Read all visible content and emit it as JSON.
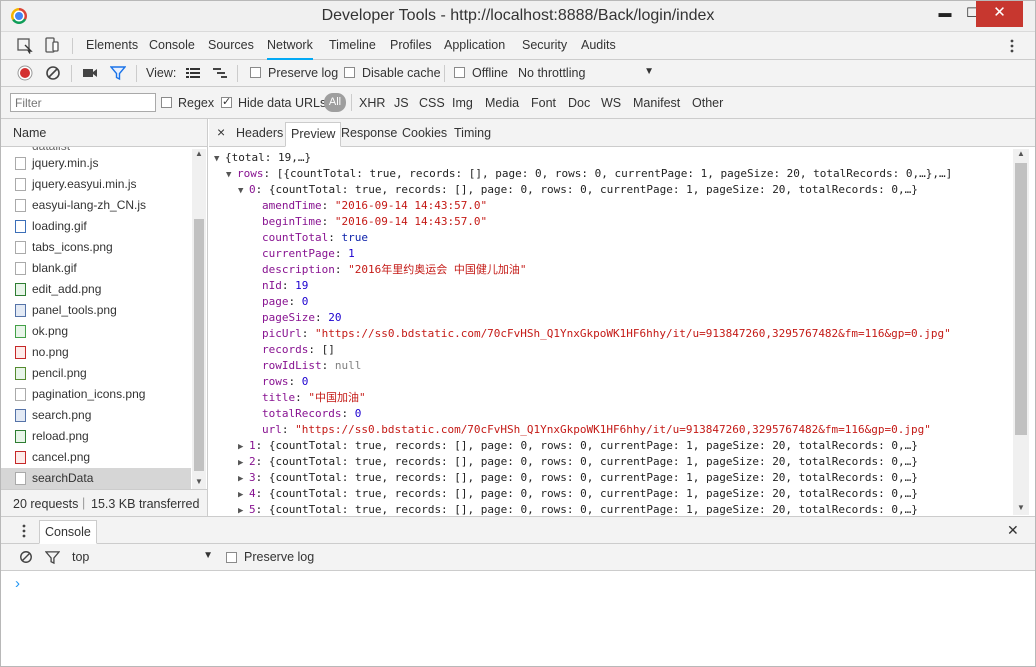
{
  "window": {
    "title": "Developer Tools - http://localhost:8888/Back/login/index",
    "min_label": "▬",
    "max_label": "☐",
    "close_label": "✕"
  },
  "tabs": [
    "Elements",
    "Console",
    "Sources",
    "Network",
    "Timeline",
    "Profiles",
    "Application",
    "Security",
    "Audits"
  ],
  "active_tab": "Network",
  "network_toolbar": {
    "view_label": "View:",
    "preserve_log": "Preserve log",
    "disable_cache": "Disable cache",
    "offline": "Offline",
    "throttling": "No throttling"
  },
  "filter_bar": {
    "placeholder": "Filter",
    "regex": "Regex",
    "hide_data_urls": "Hide data URLs",
    "all": "All",
    "types": [
      "XHR",
      "JS",
      "CSS",
      "Img",
      "Media",
      "Font",
      "Doc",
      "WS",
      "Manifest",
      "Other"
    ]
  },
  "requests": {
    "header": "Name",
    "partial": "datalist",
    "files": [
      "jquery.min.js",
      "jquery.easyui.min.js",
      "easyui-lang-zh_CN.js",
      "loading.gif",
      "tabs_icons.png",
      "blank.gif",
      "edit_add.png",
      "panel_tools.png",
      "ok.png",
      "no.png",
      "pencil.png",
      "pagination_icons.png",
      "search.png",
      "reload.png",
      "cancel.png",
      "searchData"
    ],
    "summary_count": "20 requests",
    "summary_sep": "|",
    "summary_size": "15.3 KB transferred"
  },
  "detail_tabs": [
    "Headers",
    "Preview",
    "Response",
    "Cookies",
    "Timing"
  ],
  "detail_active": "Preview",
  "detail_close": "×",
  "preview": {
    "root": "{total: 19,…}",
    "rows_key": "rows",
    "rows_summary": "[{countTotal: true, records: [], page: 0, rows: 0, currentPage: 1, pageSize: 20, totalRecords: 0,…},…]",
    "item_summary": "{countTotal: true, records: [], page: 0, rows: 0, currentPage: 1, pageSize: 20, totalRecords: 0,…}",
    "expanded_index": "0",
    "props": [
      {
        "key": "amendTime",
        "val": "\"2016-09-14 14:43:57.0\"",
        "kind": "s"
      },
      {
        "key": "beginTime",
        "val": "\"2016-09-14 14:43:57.0\"",
        "kind": "s"
      },
      {
        "key": "countTotal",
        "val": "true",
        "kind": "b"
      },
      {
        "key": "currentPage",
        "val": "1",
        "kind": "n"
      },
      {
        "key": "description",
        "val": "\"2016年里约奥运会 中国健儿加油\"",
        "kind": "s"
      },
      {
        "key": "nId",
        "val": "19",
        "kind": "n"
      },
      {
        "key": "page",
        "val": "0",
        "kind": "n"
      },
      {
        "key": "pageSize",
        "val": "20",
        "kind": "n"
      },
      {
        "key": "picUrl",
        "val": "\"https://ss0.bdstatic.com/70cFvHSh_Q1YnxGkpoWK1HF6hhy/it/u=913847260,3295767482&fm=116&gp=0.jpg\"",
        "kind": "s"
      },
      {
        "key": "records",
        "val": "[]",
        "kind": "p"
      },
      {
        "key": "rowIdList",
        "val": "null",
        "kind": "nl"
      },
      {
        "key": "rows",
        "val": "0",
        "kind": "n"
      },
      {
        "key": "title",
        "val": "\"中国加油\"",
        "kind": "s"
      },
      {
        "key": "totalRecords",
        "val": "0",
        "kind": "n"
      },
      {
        "key": "url",
        "val": "\"https://ss0.bdstatic.com/70cFvHSh_Q1YnxGkpoWK1HF6hhy/it/u=913847260,3295767482&fm=116&gp=0.jpg\"",
        "kind": "s"
      }
    ],
    "collapsed_indices": [
      "1",
      "2",
      "3",
      "4",
      "5"
    ]
  },
  "drawer": {
    "tab": "Console",
    "context": "top",
    "preserve_log": "Preserve log",
    "prompt": "›",
    "close": "✕"
  },
  "colors": {
    "accent": "#03a9f4",
    "record": "#d32f2f",
    "filter_active": "#1a73e8"
  }
}
